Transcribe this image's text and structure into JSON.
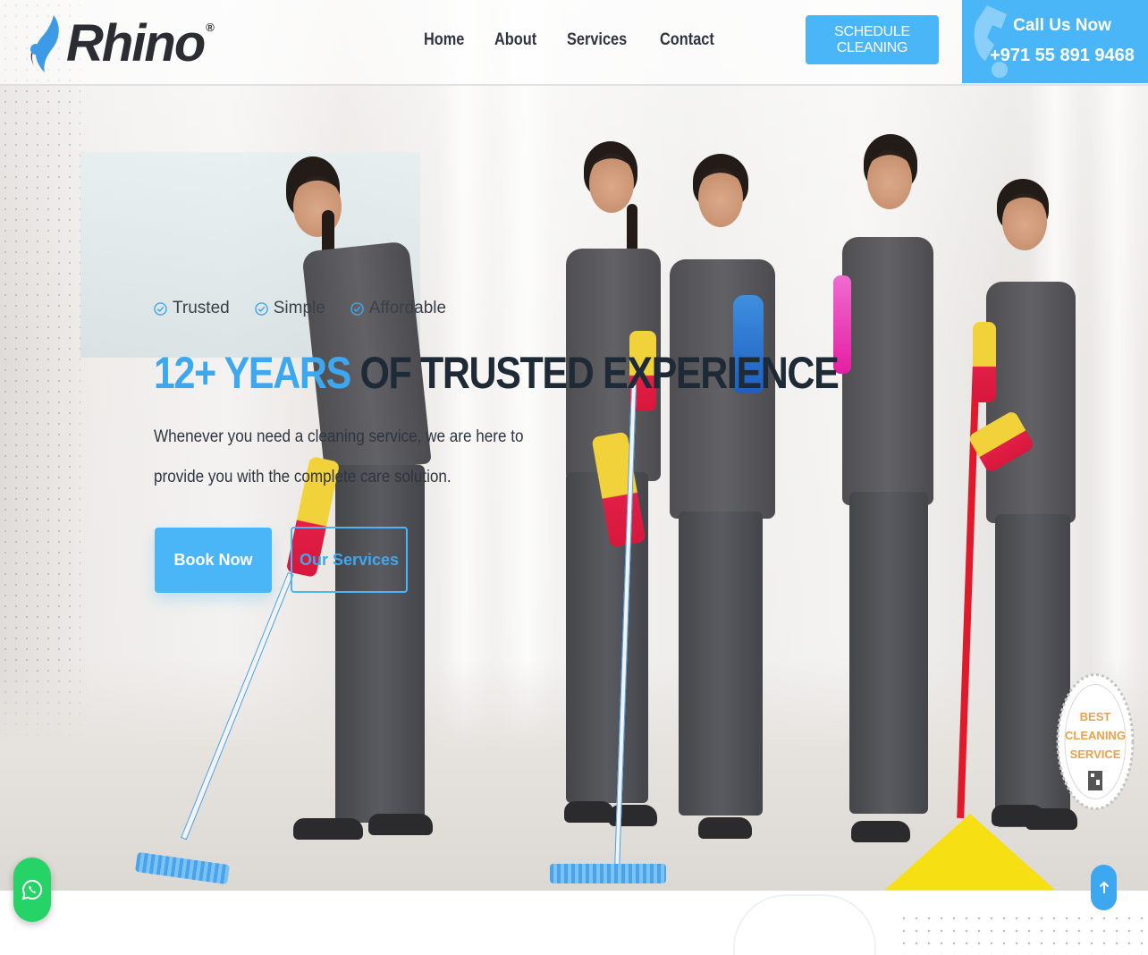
{
  "header": {
    "brand": "Rhino",
    "brand_mark": "®",
    "nav": [
      {
        "label": "Home"
      },
      {
        "label": "About"
      },
      {
        "label": "Services"
      },
      {
        "label": "Contact"
      }
    ],
    "schedule_label": "SCHEDULE CLEANING",
    "call_label": "Call Us Now",
    "call_number": "+971 55 891 9468"
  },
  "hero": {
    "badges": [
      {
        "label": "Trusted",
        "icon": "check-circle-icon"
      },
      {
        "label": "Simple",
        "icon": "check-circle-icon"
      },
      {
        "label": "Affordable",
        "icon": "check-circle-icon"
      }
    ],
    "headline_accent": "12+ YEARS",
    "headline_rest": "OF TRUSTED EXPERIENCE",
    "subtext": "Whenever you need a cleaning service, we are here to provide you with the complete care solution.",
    "book_label": "Book Now",
    "services_label": "Our Services"
  },
  "seal": {
    "line1": "BEST",
    "line2": "CLEANING",
    "line3": "SERVICE"
  },
  "floating": {
    "whatsapp_icon": "whatsapp-icon",
    "scroll_icon": "arrow-up-icon"
  },
  "colors": {
    "accent": "#4ab6f7",
    "heading": "#1f2a37",
    "whatsapp": "#25d366"
  }
}
